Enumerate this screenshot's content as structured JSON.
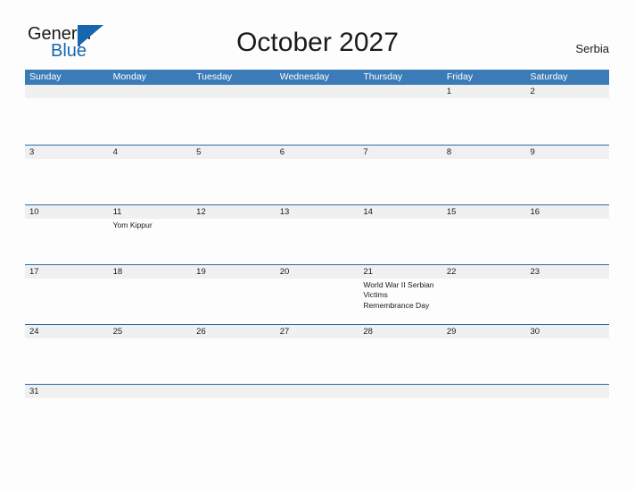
{
  "brand": {
    "name_part1": "General",
    "name_part2": "Blue",
    "mark_icon": "flag-triangle-icon",
    "accent_color": "#1666b0"
  },
  "header": {
    "title": "October 2027",
    "region": "Serbia"
  },
  "colors": {
    "header_blue": "#3b7cb8",
    "row_border_blue": "#2c6ca8",
    "date_band_gray": "#f0f0f0",
    "page_background": "#fdfdfd",
    "text": "#1a1a1a"
  },
  "calendar": {
    "month": "October",
    "year": "2027",
    "weekday_headers": [
      "Sunday",
      "Monday",
      "Tuesday",
      "Wednesday",
      "Thursday",
      "Friday",
      "Saturday"
    ],
    "weeks": [
      [
        {
          "date": "",
          "events": []
        },
        {
          "date": "",
          "events": []
        },
        {
          "date": "",
          "events": []
        },
        {
          "date": "",
          "events": []
        },
        {
          "date": "",
          "events": []
        },
        {
          "date": "1",
          "events": []
        },
        {
          "date": "2",
          "events": []
        }
      ],
      [
        {
          "date": "3",
          "events": []
        },
        {
          "date": "4",
          "events": []
        },
        {
          "date": "5",
          "events": []
        },
        {
          "date": "6",
          "events": []
        },
        {
          "date": "7",
          "events": []
        },
        {
          "date": "8",
          "events": []
        },
        {
          "date": "9",
          "events": []
        }
      ],
      [
        {
          "date": "10",
          "events": []
        },
        {
          "date": "11",
          "events": [
            "Yom Kippur"
          ]
        },
        {
          "date": "12",
          "events": []
        },
        {
          "date": "13",
          "events": []
        },
        {
          "date": "14",
          "events": []
        },
        {
          "date": "15",
          "events": []
        },
        {
          "date": "16",
          "events": []
        }
      ],
      [
        {
          "date": "17",
          "events": []
        },
        {
          "date": "18",
          "events": []
        },
        {
          "date": "19",
          "events": []
        },
        {
          "date": "20",
          "events": []
        },
        {
          "date": "21",
          "events": [
            "World War II Serbian Victims Remembrance Day"
          ]
        },
        {
          "date": "22",
          "events": []
        },
        {
          "date": "23",
          "events": []
        }
      ],
      [
        {
          "date": "24",
          "events": []
        },
        {
          "date": "25",
          "events": []
        },
        {
          "date": "26",
          "events": []
        },
        {
          "date": "27",
          "events": []
        },
        {
          "date": "28",
          "events": []
        },
        {
          "date": "29",
          "events": []
        },
        {
          "date": "30",
          "events": []
        }
      ],
      [
        {
          "date": "31",
          "events": []
        },
        {
          "date": "",
          "events": []
        },
        {
          "date": "",
          "events": []
        },
        {
          "date": "",
          "events": []
        },
        {
          "date": "",
          "events": []
        },
        {
          "date": "",
          "events": []
        },
        {
          "date": "",
          "events": []
        }
      ]
    ]
  }
}
